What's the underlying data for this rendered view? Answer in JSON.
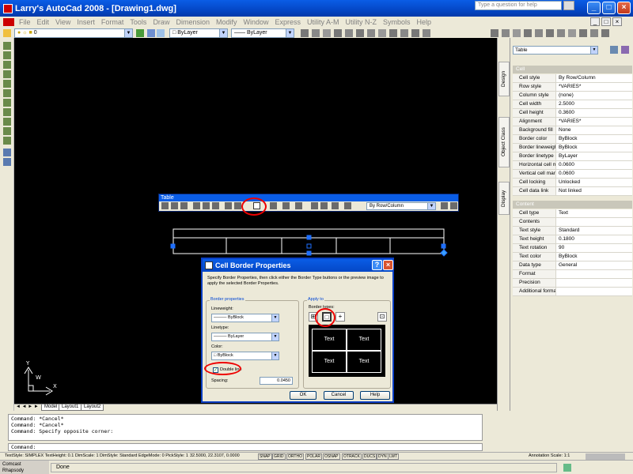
{
  "window": {
    "title": "Larry's AutoCad 2008 - [Drawing1.dwg]"
  },
  "menu": [
    "File",
    "Edit",
    "View",
    "Insert",
    "Format",
    "Tools",
    "Draw",
    "Dimension",
    "Modify",
    "Window",
    "Express",
    "Utility A-M",
    "Utility N-Z",
    "Symbols",
    "Help"
  ],
  "help_search": {
    "placeholder": "Type a question for help"
  },
  "toolbar": {
    "layer_value": "0",
    "color_value": "ByLayer",
    "linetype_value": "ByLayer",
    "lineweight_value": "ByLayer"
  },
  "table_toolbar": {
    "title": "Table",
    "cell_style_value": "By Row/Column"
  },
  "layout_tabs": [
    "Model",
    "Layout1",
    "Layout2"
  ],
  "dialog": {
    "title": "Cell Border Properties",
    "instructions": [
      "Specify Border Properties, then click either the Border Type buttons or the preview image to",
      "apply the selected Border Properties."
    ],
    "border_properties_label": "Border properties",
    "lineweight_label": "Lineweight:",
    "lineweight_value": "ByBlock",
    "linetype_label": "Linetype:",
    "linetype_value": "ByLayer",
    "color_label": "Color:",
    "color_value": "ByBlock",
    "double_line_label": "Double line",
    "double_line_checked": "✓",
    "spacing_label": "Spacing:",
    "spacing_value": "0.0450",
    "apply_to_label": "Apply to",
    "border_types_label": "Border types:",
    "preview_cells": [
      "Text",
      "Text",
      "Text",
      "Text"
    ],
    "ok_label": "OK",
    "cancel_label": "Cancel",
    "help_label": "Help"
  },
  "palette": {
    "object_type": "Table",
    "tabs": [
      "Design",
      "Object Class",
      "Display"
    ],
    "cell_section": "Cell",
    "cell_props": [
      {
        "name": "Cell style",
        "value": "By Row/Column"
      },
      {
        "name": "Row style",
        "value": "*VARIES*"
      },
      {
        "name": "Column style",
        "value": "(none)"
      },
      {
        "name": "Cell width",
        "value": "2.5000"
      },
      {
        "name": "Cell height",
        "value": "0.3600"
      },
      {
        "name": "Alignment",
        "value": "*VARIES*"
      },
      {
        "name": "Background fill",
        "value": "None"
      },
      {
        "name": "Border color",
        "value": "ByBlock"
      },
      {
        "name": "Border lineweight",
        "value": "ByBlock"
      },
      {
        "name": "Border linetype",
        "value": "ByLayer"
      },
      {
        "name": "Horizontal cell mar...",
        "value": "0.0600"
      },
      {
        "name": "Vertical cell mar...",
        "value": "0.0600"
      },
      {
        "name": "Cell locking",
        "value": "Unlocked"
      },
      {
        "name": "Cell data link",
        "value": "Not linked"
      }
    ],
    "content_section": "Content",
    "content_props": [
      {
        "name": "Cell type",
        "value": "Text"
      },
      {
        "name": "Contents",
        "value": ""
      },
      {
        "name": "Text style",
        "value": "Standard"
      },
      {
        "name": "Text height",
        "value": "0.1800"
      },
      {
        "name": "Text rotation",
        "value": "90"
      },
      {
        "name": "Text color",
        "value": "ByBlock"
      },
      {
        "name": "Data type",
        "value": "General"
      },
      {
        "name": "Format",
        "value": ""
      },
      {
        "name": "Precision",
        "value": ""
      },
      {
        "name": "Additional format",
        "value": ""
      }
    ]
  },
  "command": {
    "history": [
      "Command: *Cancel*",
      "Command: *Cancel*",
      "Command: Specify opposite corner:"
    ],
    "prompt": "Command:"
  },
  "status": {
    "info": "TextStyle: SIMPLEX  TextHeight: 0.1  DimScale: 1  DimStyle: Standard  EdgeMode: 0  PickStyle: 1",
    "coords": "32.5000, 22.3107, 0.0000",
    "toggles": [
      "SNAP",
      "GRID",
      "ORTHO",
      "POLAR",
      "OSNAP",
      "OTRACK",
      "DUCS",
      "DYN",
      "LWT"
    ],
    "annotation_scale": "Annotation Scale: 1:1"
  },
  "bottom": {
    "left_lines": [
      "Comcast",
      "Rhapsody"
    ],
    "done": "Done"
  },
  "colors": {
    "accent": "#e00000",
    "title_blue": "#0a5de6",
    "canvas": "#000000",
    "grip": "#1e6fff"
  }
}
